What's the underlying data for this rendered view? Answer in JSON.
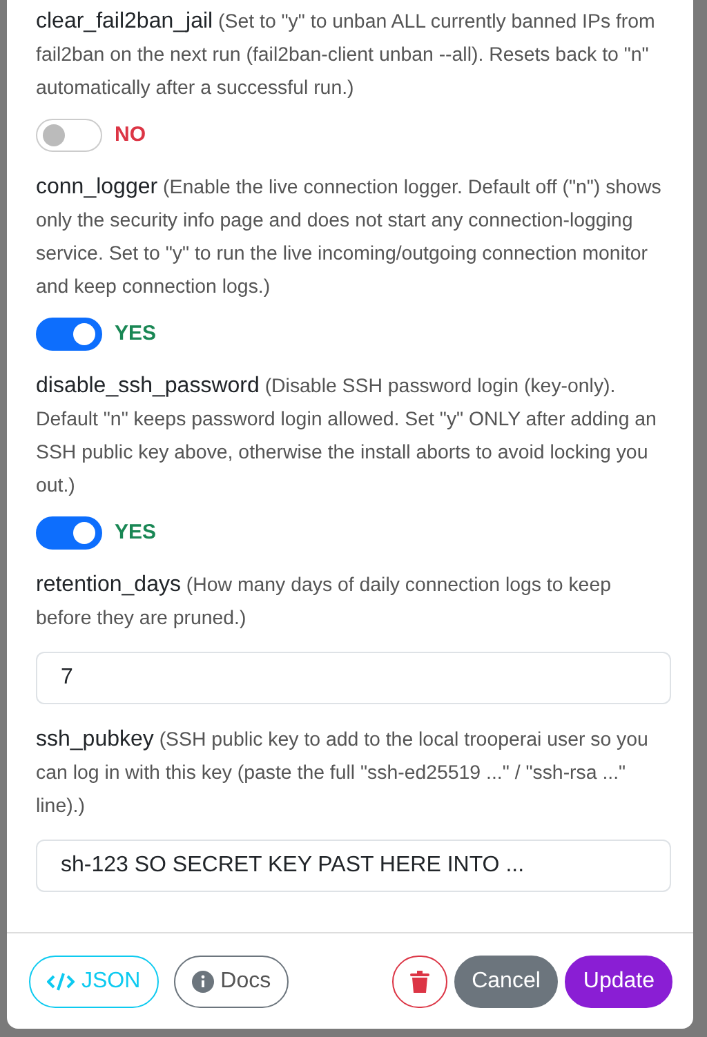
{
  "fields": [
    {
      "kind": "toggle",
      "name": "clear_fail2ban_jail",
      "description": "(Set to \"y\" to unban ALL currently banned IPs from fail2ban on the next run (fail2ban-client unban --all). Resets back to \"n\" automatically after a successful run.)",
      "on": false,
      "state_label": "NO"
    },
    {
      "kind": "toggle",
      "name": "conn_logger",
      "description": "(Enable the live connection logger. Default off (\"n\") shows only the security info page and does not start any connection-logging service. Set to \"y\" to run the live incoming/outgoing connection monitor and keep connection logs.)",
      "on": true,
      "state_label": "YES"
    },
    {
      "kind": "toggle",
      "name": "disable_ssh_password",
      "description": "(Disable SSH password login (key-only). Default \"n\" keeps password login allowed. Set \"y\" ONLY after adding an SSH public key above, otherwise the install aborts to avoid locking you out.)",
      "on": true,
      "state_label": "YES"
    },
    {
      "kind": "text",
      "name": "retention_days",
      "description": "(How many days of daily connection logs to keep before they are pruned.)",
      "value": "7"
    },
    {
      "kind": "text",
      "name": "ssh_pubkey",
      "description": "(SSH public key to add to the local trooperai user so you can log in with this key (paste the full \"ssh-ed25519 ...\" / \"ssh-rsa ...\" line).)",
      "value": "sh-123 SO SECRET KEY PAST HERE INTO ..."
    }
  ],
  "footer": {
    "json_button": "JSON",
    "docs_button": "Docs",
    "cancel_button": "Cancel",
    "update_button": "Update"
  }
}
